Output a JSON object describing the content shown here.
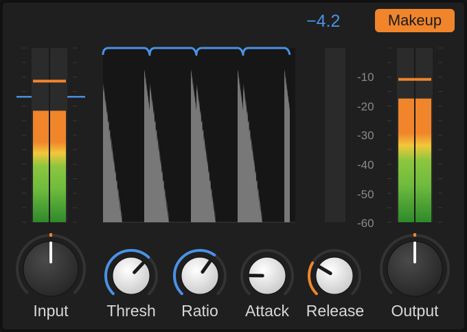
{
  "gain_reduction_readout": "−4.2",
  "makeup_button": {
    "label": "Makeup"
  },
  "db_scale": [
    "-10",
    "-20",
    "-30",
    "-40",
    "-50",
    "-60"
  ],
  "knobs": [
    {
      "label": "Input",
      "value": 0.5
    },
    {
      "label": "Thresh",
      "value": 0.66
    },
    {
      "label": "Ratio",
      "value": 0.63
    },
    {
      "label": "Attack",
      "value": 0.17
    },
    {
      "label": "Release",
      "value": 0.28
    },
    {
      "label": "Output",
      "value": 0.5
    }
  ],
  "input_meter": {
    "level": 0.64,
    "peak": 0.81,
    "threshold": 0.72
  },
  "output_meter": {
    "level": 0.71,
    "peak": 0.82
  },
  "gain_reduction_meter": {
    "level": 0.0
  },
  "colors": {
    "accent_blue": "#4a92e6",
    "accent_orange": "#f0852c",
    "background": "#1f1f1f",
    "meter_green": "#6fbb3e",
    "meter_yellow": "#f1c83a",
    "meter_orange": "#f0852c"
  }
}
